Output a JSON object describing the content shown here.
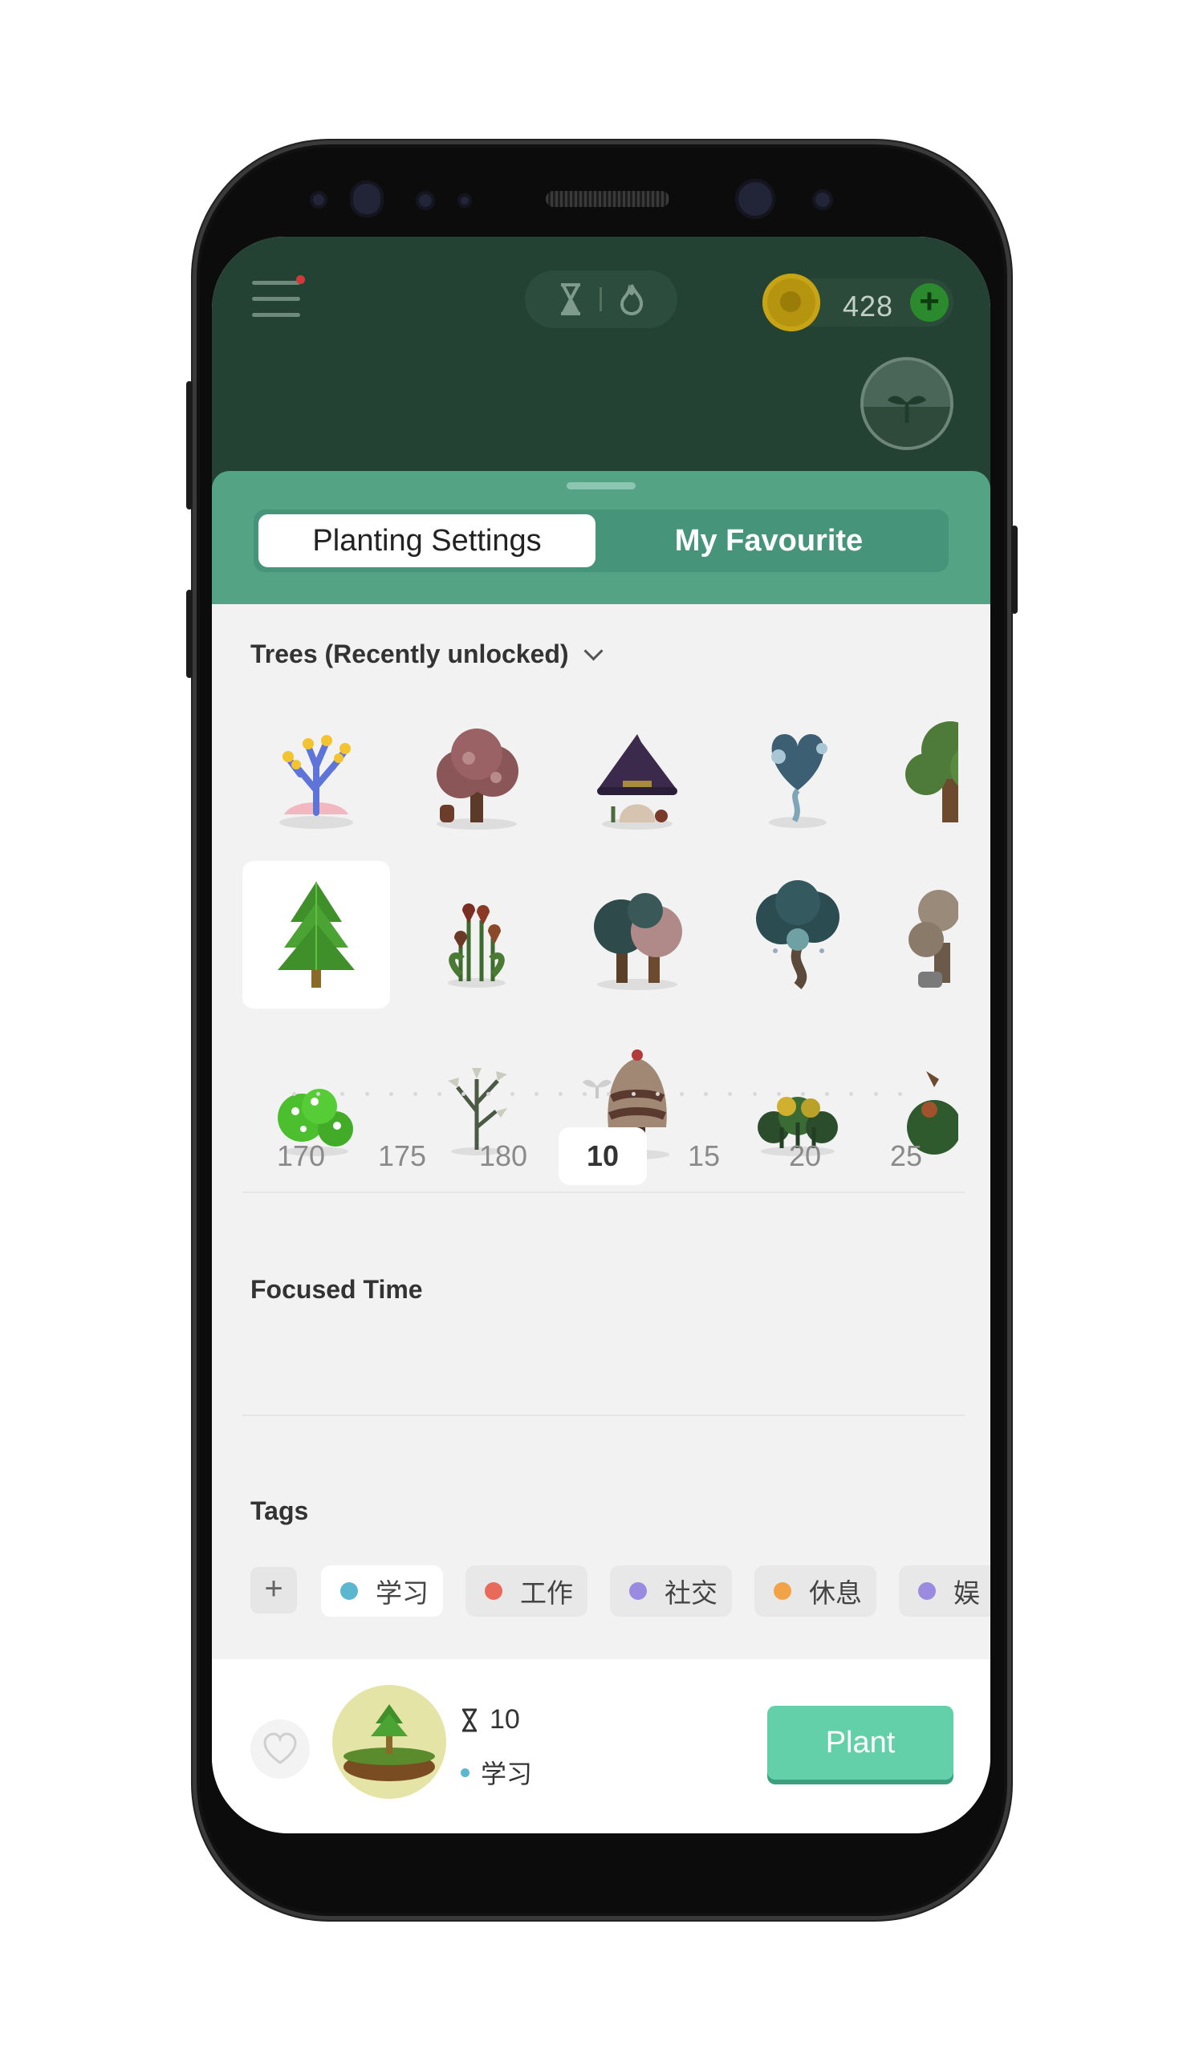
{
  "header": {
    "coin_count": "428",
    "icons": [
      "menu-icon",
      "hourglass-icon",
      "flame-icon",
      "coin-icon",
      "plus-icon",
      "sprout-icon"
    ]
  },
  "tabs": {
    "planting_settings": "Planting Settings",
    "my_favourite": "My Favourite",
    "active": "Planting Settings"
  },
  "trees": {
    "section_title": "Trees (Recently unlocked)",
    "rows": [
      [
        "coral-bush",
        "pink-blossom-tree",
        "witch-hat-mushroom",
        "heart-fountain-tree",
        "willow-tree"
      ],
      [
        "pine-tree",
        "tulips",
        "twin-trees",
        "lantern-tree",
        "bonsai-tree"
      ],
      [
        "green-bush",
        "lily-plant",
        "cupcake-tree",
        "clover-bush",
        "dragon-bush"
      ]
    ],
    "selected": "pine-tree"
  },
  "focused_time": {
    "title": "Focused Time",
    "values": [
      "170",
      "175",
      "180",
      "10",
      "15",
      "20",
      "25"
    ],
    "selected": "10"
  },
  "tags": {
    "title": "Tags",
    "add_label": "+",
    "items": [
      {
        "label": "学习",
        "color": "#5bb7cf"
      },
      {
        "label": "工作",
        "color": "#e86a5b"
      },
      {
        "label": "社交",
        "color": "#9a8be0"
      },
      {
        "label": "休息",
        "color": "#f2a347"
      },
      {
        "label": "娱",
        "color": "#9a8be0"
      }
    ],
    "selected": "学习"
  },
  "bottom": {
    "time": "10",
    "tag": "学习",
    "tag_color": "#5bb7cf",
    "plant_label": "Plant"
  },
  "colors": {
    "header_bg": "#234233",
    "sheet_accent": "#54a384",
    "plant_button": "#63d0a9"
  }
}
